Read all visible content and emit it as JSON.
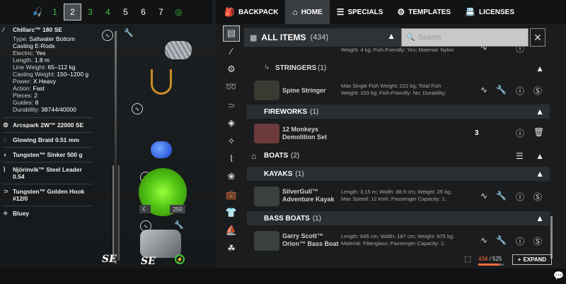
{
  "slots": {
    "items": [
      "1",
      "2",
      "3",
      "4",
      "5",
      "6",
      "7"
    ]
  },
  "rod": {
    "name": "Chillarc™ 180 SE",
    "props": [
      {
        "k": "Type:",
        "v": "Saltwater Bottom Casting E-Rods"
      },
      {
        "k": "Electric:",
        "v": "Yes"
      },
      {
        "k": "Length:",
        "v": "1.8 m"
      },
      {
        "k": "Line Weight:",
        "v": "65–112 kg"
      },
      {
        "k": "Casting Weight:",
        "v": "150–1200 g"
      },
      {
        "k": "Power:",
        "v": "X Heavy"
      },
      {
        "k": "Action:",
        "v": "Fast"
      },
      {
        "k": "Pieces:",
        "v": "2"
      },
      {
        "k": "Guides:",
        "v": "8"
      },
      {
        "k": "Durability:",
        "v": "38744/40000"
      }
    ],
    "parts": [
      "Arcspark 2W™ 22000 SE",
      "Glowing Braid 0.51 mm",
      "Tungsten™ Sinker 500 g",
      "Njörinvik™ Steel Leader 0.54",
      "Tungsten™ Golden Hook #12/0",
      "Bluey"
    ],
    "line_amount": "250",
    "logo_text": "SE",
    "reel_logo_text": "SE"
  },
  "tabs": [
    {
      "label": "BACKPACK",
      "icon": "backpack-icon"
    },
    {
      "label": "HOME",
      "icon": "home-icon"
    },
    {
      "label": "SPECIALS",
      "icon": "specials-icon"
    },
    {
      "label": "TEMPLATES",
      "icon": "templates-icon"
    },
    {
      "label": "LICENSES",
      "icon": "licenses-icon"
    }
  ],
  "list": {
    "title": "ALL ITEMS",
    "count": "(434)",
    "search_placeholder": "Search",
    "prev_desc": "Weight: 4 kg; Fish-Friendly: Yes; Material: Nylon",
    "categories": [
      {
        "label": "STRINGERS",
        "count": "(1)"
      },
      {
        "label": "FIREWORKS",
        "count": "(1)"
      },
      {
        "label": "BOATS",
        "count": "(2)"
      },
      {
        "label": "KAYAKS",
        "count": "(1)"
      },
      {
        "label": "BASS BOATS",
        "count": "(1)"
      }
    ],
    "items": [
      {
        "name": "Spine Stringer",
        "desc": "Max Single Fish Weight: 222 kg; Total Fish Weight: 333 kg; Fish-Friendly: No; Durability:"
      },
      {
        "name": "12 Monkeys Demolition Set",
        "qty": "3"
      },
      {
        "name": "SilverGull™ Adventure Kayak",
        "desc": "Length: 3.15 m; Width: 88.9 cm; Weight: 25 kg; Max Speed: 12 kmh; Passenger Capacity: 1;"
      },
      {
        "name": "Garry Scott™ Orion™ Bass Boat",
        "desc": "Length: 645 cm; Width: 187 cm; Weight: 975 kg; Material: Fiberglass; Passenger Capacity: 1;"
      }
    ]
  },
  "footer": {
    "capacity_used": "434",
    "capacity_total": "525",
    "capacity_fraction": 0.827,
    "expand_label": "EXPAND"
  },
  "colors": {
    "accent_green": "#3ec03e",
    "capacity_orange": "#ff6a3d"
  }
}
